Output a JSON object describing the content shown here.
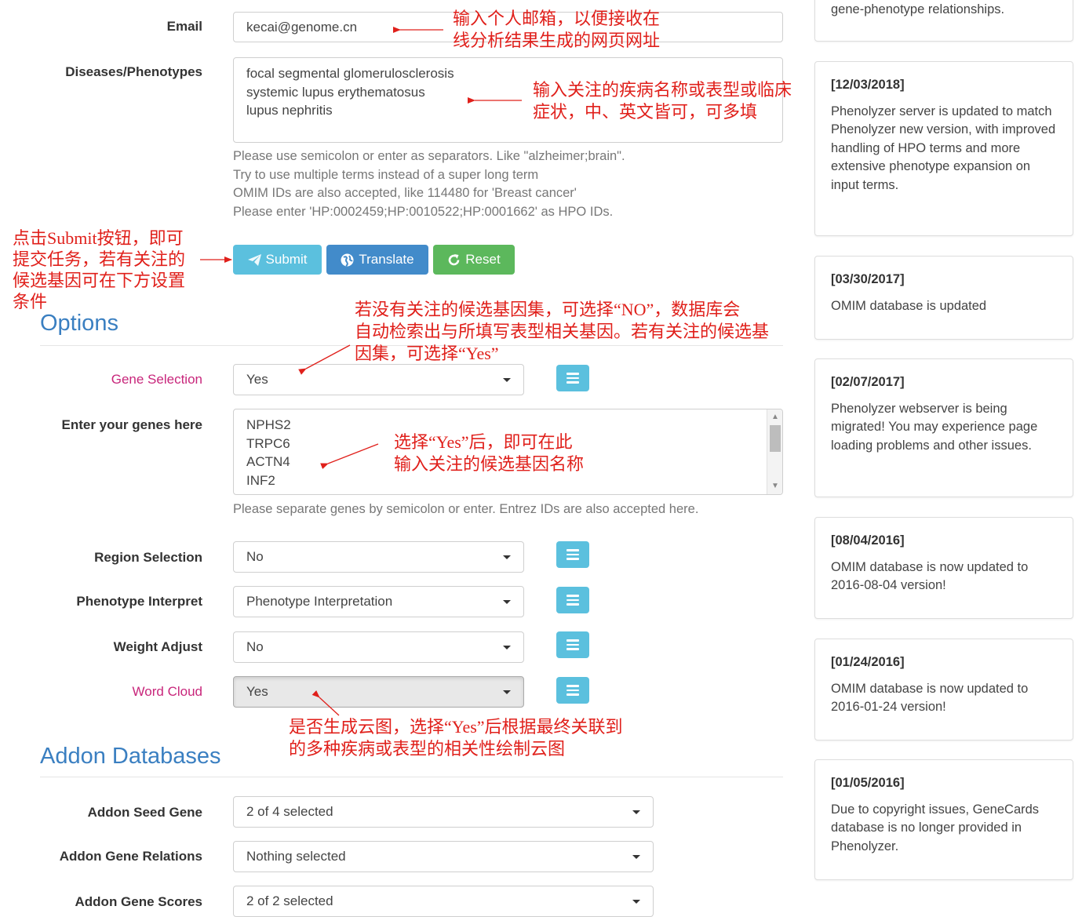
{
  "form": {
    "email": {
      "label": "Email",
      "value": "kecai@genome.cn"
    },
    "diseases": {
      "label": "Diseases/Phenotypes",
      "lines": [
        "focal segmental glomerulosclerosis",
        "systemic lupus erythematosus",
        "lupus nephritis"
      ],
      "help": [
        "Please use semicolon or enter as separators. Like \"alzheimer;brain\".",
        "Try to use multiple terms instead of a super long term",
        "OMIM IDs are also accepted, like 114480 for 'Breast cancer'",
        "Please enter 'HP:0002459;HP:0010522;HP:0001662' as HPO IDs."
      ]
    },
    "buttons": {
      "submit": "Submit",
      "translate": "Translate",
      "reset": "Reset"
    }
  },
  "options": {
    "heading": "Options",
    "gene_selection": {
      "label": "Gene Selection",
      "value": "Yes"
    },
    "genes": {
      "label": "Enter your genes here",
      "lines": [
        "NPHS2",
        "TRPC6",
        "ACTN4",
        "INF2"
      ],
      "help": "Please separate genes by semicolon or enter. Entrez IDs are also accepted here."
    },
    "region_selection": {
      "label": "Region Selection",
      "value": "No"
    },
    "phenotype_interpret": {
      "label": "Phenotype Interpret",
      "value": "Phenotype Interpretation"
    },
    "weight_adjust": {
      "label": "Weight Adjust",
      "value": "No"
    },
    "word_cloud": {
      "label": "Word Cloud",
      "value": "Yes"
    }
  },
  "addon": {
    "heading": "Addon Databases",
    "seed_gene": {
      "label": "Addon Seed Gene",
      "value": "2 of 4 selected"
    },
    "gene_relations": {
      "label": "Addon Gene Relations",
      "value": "Nothing selected"
    },
    "gene_scores": {
      "label": "Addon Gene Scores",
      "value": "2 of 2 selected"
    }
  },
  "news": {
    "top_fragment": "gene-phenotype relationships.",
    "items": [
      {
        "date": "[12/03/2018]",
        "text": "Phenolyzer server is updated to match Phenolyzer new version, with improved handling of HPO terms and more extensive phenotype expansion on input terms."
      },
      {
        "date": "[03/30/2017]",
        "text": "OMIM database is updated"
      },
      {
        "date": "[02/07/2017]",
        "text": "Phenolyzer webserver is being migrated! You may experience page loading problems and other issues."
      },
      {
        "date": "[08/04/2016]",
        "text": "OMIM database is now updated to 2016-08-04 version!"
      },
      {
        "date": "[01/24/2016]",
        "text": "OMIM database is now updated to 2016-01-24 version!"
      },
      {
        "date": "[01/05/2016]",
        "text": "Due to copyright issues, GeneCards database is no longer provided in Phenolyzer."
      }
    ]
  },
  "annotations": {
    "email": [
      "输入个人邮箱，以便接收在",
      "线分析结果生成的网页网址"
    ],
    "diseases": [
      "输入关注的疾病名称或表型或临床",
      "症状，中、英文皆可，可多填"
    ],
    "submit": [
      "点击Submit按钮，即可",
      "提交任务，若有关注的",
      "候选基因可在下方设置",
      "条件"
    ],
    "gene_selection": [
      "若没有关注的候选基因集，可选择“NO”，数据库会",
      "自动检索出与所填写表型相关基因。若有关注的候选基",
      "因集，可选择“Yes”"
    ],
    "genes": [
      "选择“Yes”后，即可在此",
      "输入关注的候选基因名称"
    ],
    "word_cloud": [
      "是否生成云图，选择“Yes”后根据最终关联到",
      "的多种疾病或表型的相关性绘制云图"
    ]
  },
  "colors": {
    "accent": "#3a7fc1",
    "annotation": "#e0201b",
    "label_pink": "#c8267b",
    "submit": "#5bc0de",
    "translate": "#428bca",
    "reset": "#5cb85c"
  }
}
